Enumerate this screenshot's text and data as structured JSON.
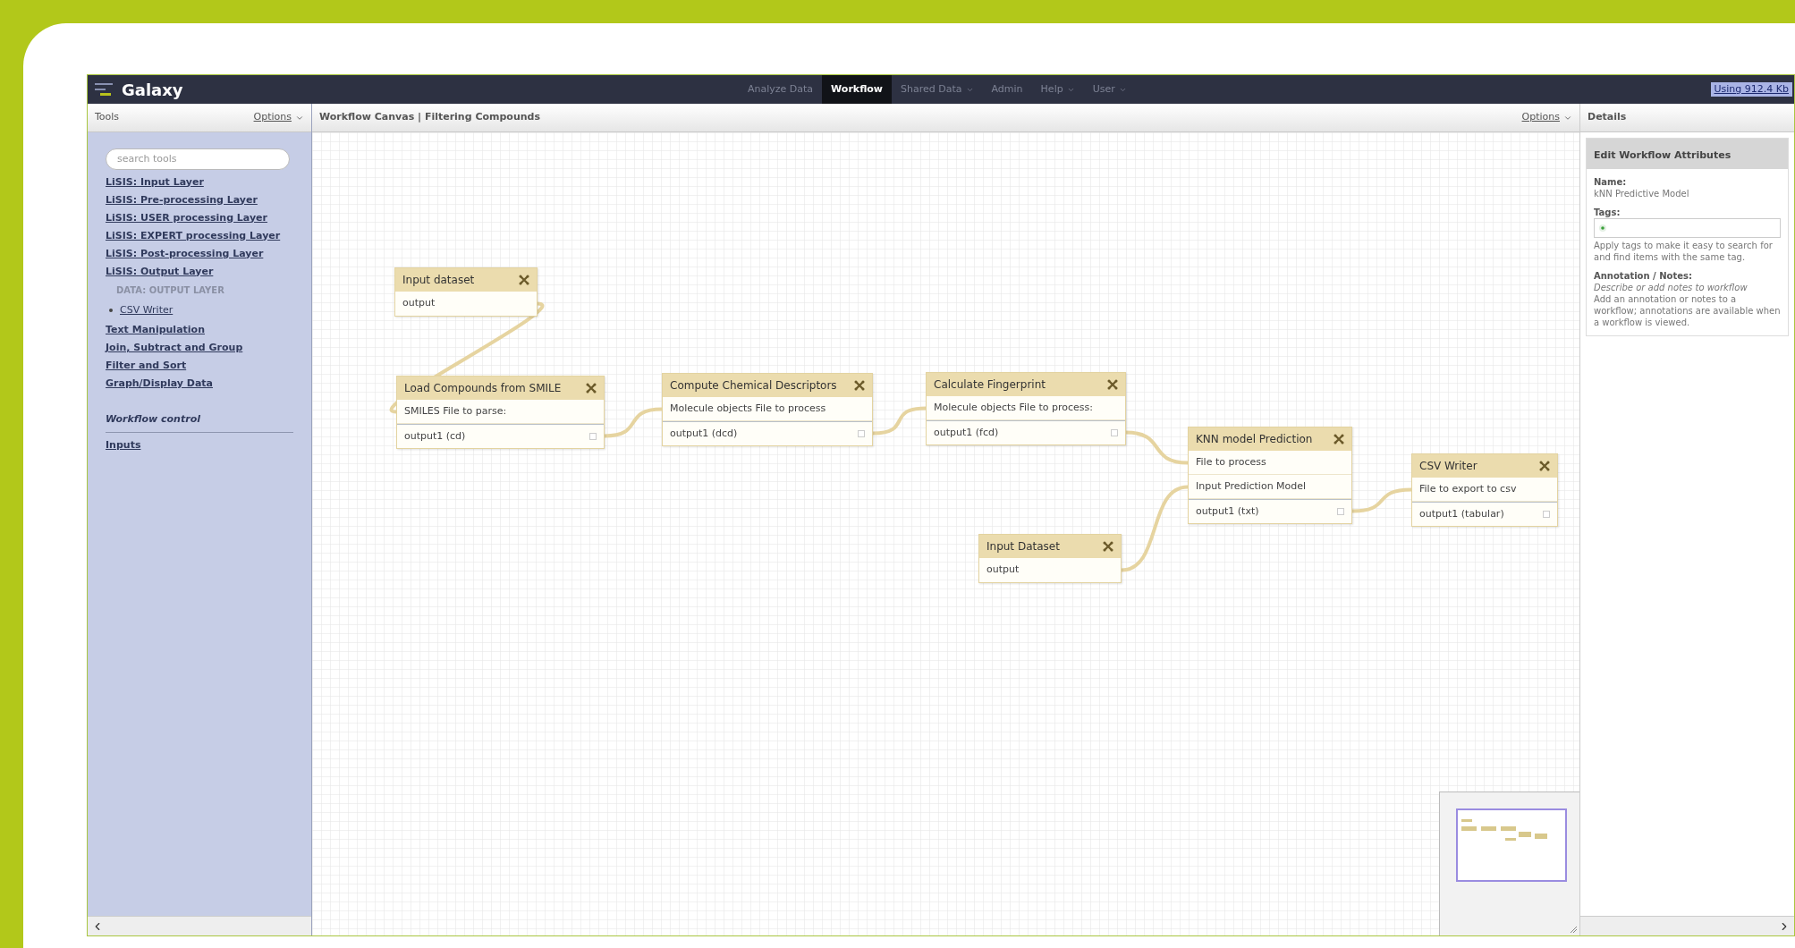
{
  "topbar": {
    "brand": "Galaxy",
    "nav": [
      {
        "label": "Analyze Data",
        "selected": false,
        "has_menu": false
      },
      {
        "label": "Workflow",
        "selected": true,
        "has_menu": false
      },
      {
        "label": "Shared Data",
        "selected": false,
        "has_menu": true
      },
      {
        "label": "Admin",
        "selected": false,
        "has_menu": false
      },
      {
        "label": "Help",
        "selected": false,
        "has_menu": true
      },
      {
        "label": "User",
        "selected": false,
        "has_menu": true
      }
    ],
    "usage": "Using 912.4 Kb"
  },
  "tools_panel": {
    "title": "Tools",
    "options": "Options",
    "search": {
      "placeholder": "search tools"
    },
    "items": [
      {
        "kind": "section",
        "label": "LiSIS: Input Layer"
      },
      {
        "kind": "section",
        "label": "LiSIS: Pre-processing Layer"
      },
      {
        "kind": "section",
        "label": "LiSIS: USER processing Layer"
      },
      {
        "kind": "section",
        "label": "LiSIS: EXPERT processing Layer"
      },
      {
        "kind": "section",
        "label": "LiSIS: Post-processing Layer"
      },
      {
        "kind": "section",
        "label": "LiSIS: Output Layer"
      },
      {
        "kind": "label",
        "label": "DATA: OUTPUT LAYER"
      },
      {
        "kind": "tool",
        "label": "CSV Writer"
      },
      {
        "kind": "section",
        "label": "Text Manipulation"
      },
      {
        "kind": "section",
        "label": "Join, Subtract and Group"
      },
      {
        "kind": "section",
        "label": "Filter and Sort"
      },
      {
        "kind": "section",
        "label": "Graph/Display Data"
      },
      {
        "kind": "heading",
        "label": "Workflow control"
      },
      {
        "kind": "section",
        "label": "Inputs"
      }
    ]
  },
  "canvas": {
    "title": "Workflow Canvas | Filtering Compounds",
    "options": "Options",
    "nodes": [
      {
        "title": "Input dataset",
        "outputs": [
          "output"
        ]
      },
      {
        "title": "Load Compounds from SMILE",
        "inputs": [
          "SMILES File to parse:"
        ],
        "outputs": [
          "output1 (cd)"
        ]
      },
      {
        "title": "Compute Chemical Descriptors",
        "inputs": [
          "Molecule objects File to process"
        ],
        "outputs": [
          "output1 (dcd)"
        ]
      },
      {
        "title": "Calculate Fingerprint",
        "inputs": [
          "Molecule objects File to process:"
        ],
        "outputs": [
          "output1 (fcd)"
        ]
      },
      {
        "title": "KNN model Prediction",
        "inputs": [
          "File to process",
          "Input Prediction Model"
        ],
        "outputs": [
          "output1 (txt)"
        ]
      },
      {
        "title": "Input Dataset",
        "outputs": [
          "output"
        ]
      },
      {
        "title": "CSV Writer",
        "inputs": [
          "File to export to csv"
        ],
        "outputs": [
          "output1 (tabular)"
        ]
      }
    ]
  },
  "details": {
    "title": "Details",
    "form_title": "Edit Workflow Attributes",
    "name_label": "Name:",
    "name_value": "kNN Predictive Model",
    "tags_label": "Tags:",
    "tags_help": "Apply tags to make it easy to search for and find items with the same tag.",
    "annotation_label": "Annotation / Notes:",
    "annotation_placeholder": "Describe or add notes to workflow",
    "annotation_help": "Add an annotation or notes to a workflow; annotations are available when a workflow is viewed."
  }
}
